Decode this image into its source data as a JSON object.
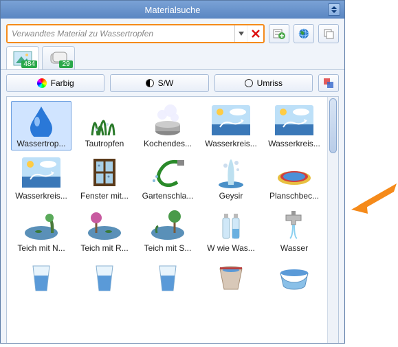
{
  "title": "Materialsuche",
  "search": {
    "value": "Verwandtes Material zu Wassertropfen"
  },
  "tabs": {
    "images_count": "484",
    "other_count": "29"
  },
  "filters": {
    "color": "Farbig",
    "bw": "S/W",
    "outline": "Umriss"
  },
  "items": [
    {
      "label": "Wassertrop..."
    },
    {
      "label": "Tautropfen"
    },
    {
      "label": "Kochendes..."
    },
    {
      "label": "Wasserkreis..."
    },
    {
      "label": "Wasserkreis..."
    },
    {
      "label": "Wasserkreis..."
    },
    {
      "label": "Fenster mit..."
    },
    {
      "label": "Gartenschla..."
    },
    {
      "label": "Geysir"
    },
    {
      "label": "Planschbec..."
    },
    {
      "label": "Teich mit N..."
    },
    {
      "label": "Teich mit R..."
    },
    {
      "label": "Teich mit S..."
    },
    {
      "label": "W wie Was..."
    },
    {
      "label": "Wasser"
    },
    {
      "label": ""
    },
    {
      "label": ""
    },
    {
      "label": ""
    },
    {
      "label": ""
    },
    {
      "label": ""
    }
  ]
}
